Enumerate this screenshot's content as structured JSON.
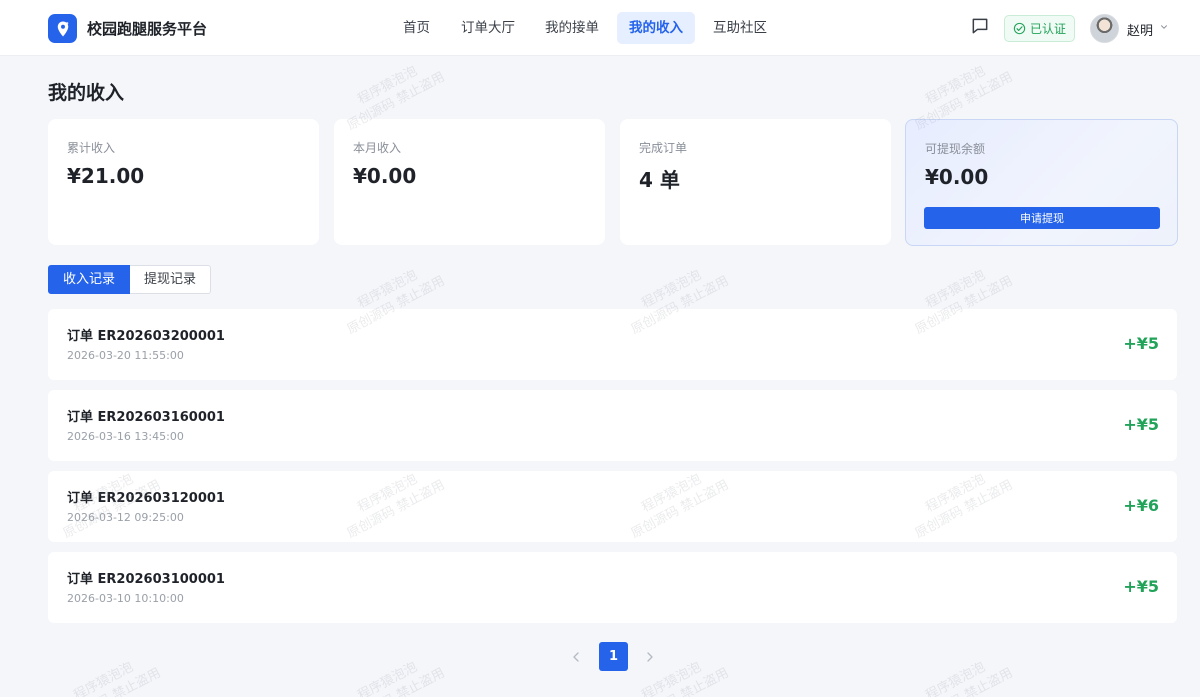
{
  "header": {
    "brand": "校园跑腿服务平台",
    "nav": [
      {
        "label": "首页",
        "active": false
      },
      {
        "label": "订单大厅",
        "active": false
      },
      {
        "label": "我的接单",
        "active": false
      },
      {
        "label": "我的收入",
        "active": true
      },
      {
        "label": "互助社区",
        "active": false
      }
    ],
    "verified_label": "已认证",
    "user_name": "赵明"
  },
  "page": {
    "title": "我的收入"
  },
  "stats": [
    {
      "label": "累计收入",
      "value": "¥21.00"
    },
    {
      "label": "本月收入",
      "value": "¥0.00"
    },
    {
      "label": "完成订单",
      "value": "4 单"
    },
    {
      "label": "可提现余额",
      "value": "¥0.00",
      "action": "申请提现"
    }
  ],
  "tabs": [
    {
      "label": "收入记录",
      "active": true
    },
    {
      "label": "提现记录",
      "active": false
    }
  ],
  "records": [
    {
      "title": "订单 ER202603200001",
      "time": "2026-03-20 11:55:00",
      "amount": "+¥5"
    },
    {
      "title": "订单 ER202603160001",
      "time": "2026-03-16 13:45:00",
      "amount": "+¥5"
    },
    {
      "title": "订单 ER202603120001",
      "time": "2026-03-12 09:25:00",
      "amount": "+¥6"
    },
    {
      "title": "订单 ER202603100001",
      "time": "2026-03-10 10:10:00",
      "amount": "+¥5"
    }
  ],
  "pagination": {
    "current": "1"
  },
  "watermark": {
    "line1": "程序猿泡泡",
    "line2": "原创源码 禁止盗用"
  },
  "colors": {
    "primary": "#2563eb",
    "income_green": "#22a35a",
    "page_bg": "#f4f6fa"
  },
  "icons": {
    "logo": "location-pin-icon",
    "message": "chat-bubble-icon",
    "verified": "check-circle-icon",
    "user_menu": "chevron-down-icon",
    "prev": "chevron-left-icon",
    "next": "chevron-right-icon"
  }
}
